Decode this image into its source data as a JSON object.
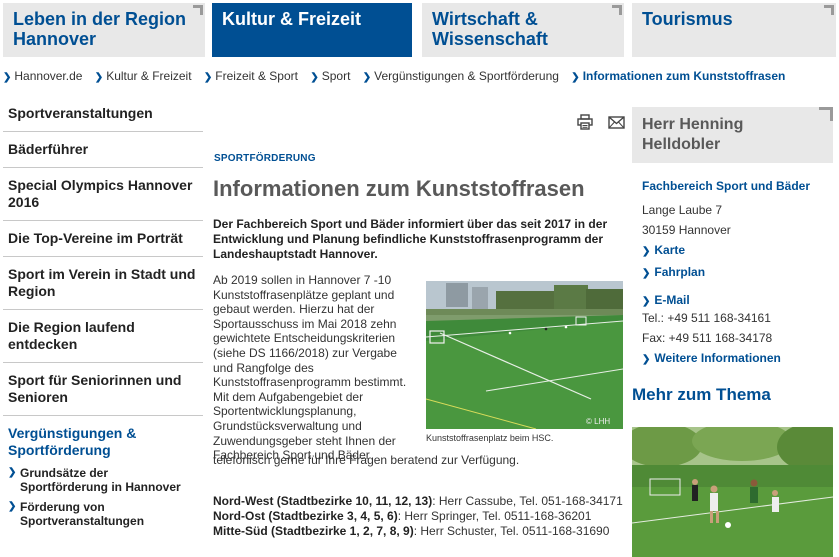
{
  "topnav": [
    {
      "label_line1": "Leben in der Region",
      "label_line2": "Hannover",
      "active": false
    },
    {
      "label_line1": "Kultur & Freizeit",
      "label_line2": "",
      "active": true
    },
    {
      "label_line1": "Wirtschaft &",
      "label_line2": "Wissenschaft",
      "active": false
    },
    {
      "label_line1": "Tourismus",
      "label_line2": "",
      "active": false
    }
  ],
  "breadcrumb": [
    "Hannover.de",
    "Kultur & Freizeit",
    "Freizeit & Sport",
    "Sport",
    "Vergünstigungen & Sportförderung",
    "Informationen zum Kunststoffrasen"
  ],
  "sidebar": {
    "items": [
      "Sportveranstaltungen",
      "Bäderführer",
      "Special Olympics Hannover 2016",
      "Die Top-Vereine im Porträt",
      "Sport im Verein in Stadt und Region",
      "Die Region laufend entdecken",
      "Sport für Seniorinnen und Senioren"
    ],
    "active": "Vergünstigungen & Sportförderung",
    "subitems": [
      "Grundsätze der Sportförderung in Hannover",
      "Förderung von Sportveranstaltungen"
    ]
  },
  "main": {
    "kicker": "SPORTFÖRDERUNG",
    "title": "Informationen zum Kunststoffrasen",
    "lead": "Der Fachbereich Sport und Bäder informiert über das seit 2017 in der Entwicklung und Planung befindliche Kunststoffrasenprogramm der Landeshauptstadt Hannover.",
    "body": "Ab 2019 sollen in Hannover 7 -10 Kunststoffrasenplätze geplant und gebaut werden. Hierzu hat der Sportausschuss im Mai 2018 zehn gewichtete Entscheidungskriterien (siehe DS 1166/2018) zur Vergabe und Rangfolge des Kunststoffrasenprogramm bestimmt. Mit dem Aufgabengebiet der Sportentwicklungsplanung, Grundstücksverwaltung und Zuwendungsgeber steht Ihnen der Fachbereich Sport und Bäder",
    "body_tail": "telefonisch gerne für Ihre Fragen beratend zur Verfügung.",
    "photo_credit": "© LHH",
    "caption": "Kunststoffrasenplatz beim HSC.",
    "contacts": [
      {
        "region": "Nord-West (Stadtbezirke 10, 11, 12, 13)",
        "text": ": Herr Cassube, Tel. 051-168-34171"
      },
      {
        "region": "Nord-Ost (Stadtbezirke 3, 4, 5, 6)",
        "text": ": Herr Springer, Tel. 0511-168-36201"
      },
      {
        "region": "Mitte-Süd (Stadtbezirke 1, 2, 7, 8, 9)",
        "text": ": Herr Schuster, Tel. 0511-168-31690"
      }
    ]
  },
  "contact": {
    "name": "Herr Henning Helldobler",
    "dept": "Fachbereich Sport und Bäder",
    "street": "Lange Laube 7",
    "city": "30159 Hannover",
    "links": [
      "Karte",
      "Fahrplan"
    ],
    "email": "E-Mail",
    "tel": "Tel.: +49 511 168-34161",
    "fax": "Fax: +49 511 168-34178",
    "more_info": "Weitere Informationen"
  },
  "more_title": "Mehr zum Thema",
  "colors": {
    "brand_blue": "#004f93",
    "tab_grey": "#e8e8e8",
    "title_grey": "#595959"
  },
  "icons": [
    "print-icon",
    "mail-icon",
    "chevron-right-icon"
  ]
}
